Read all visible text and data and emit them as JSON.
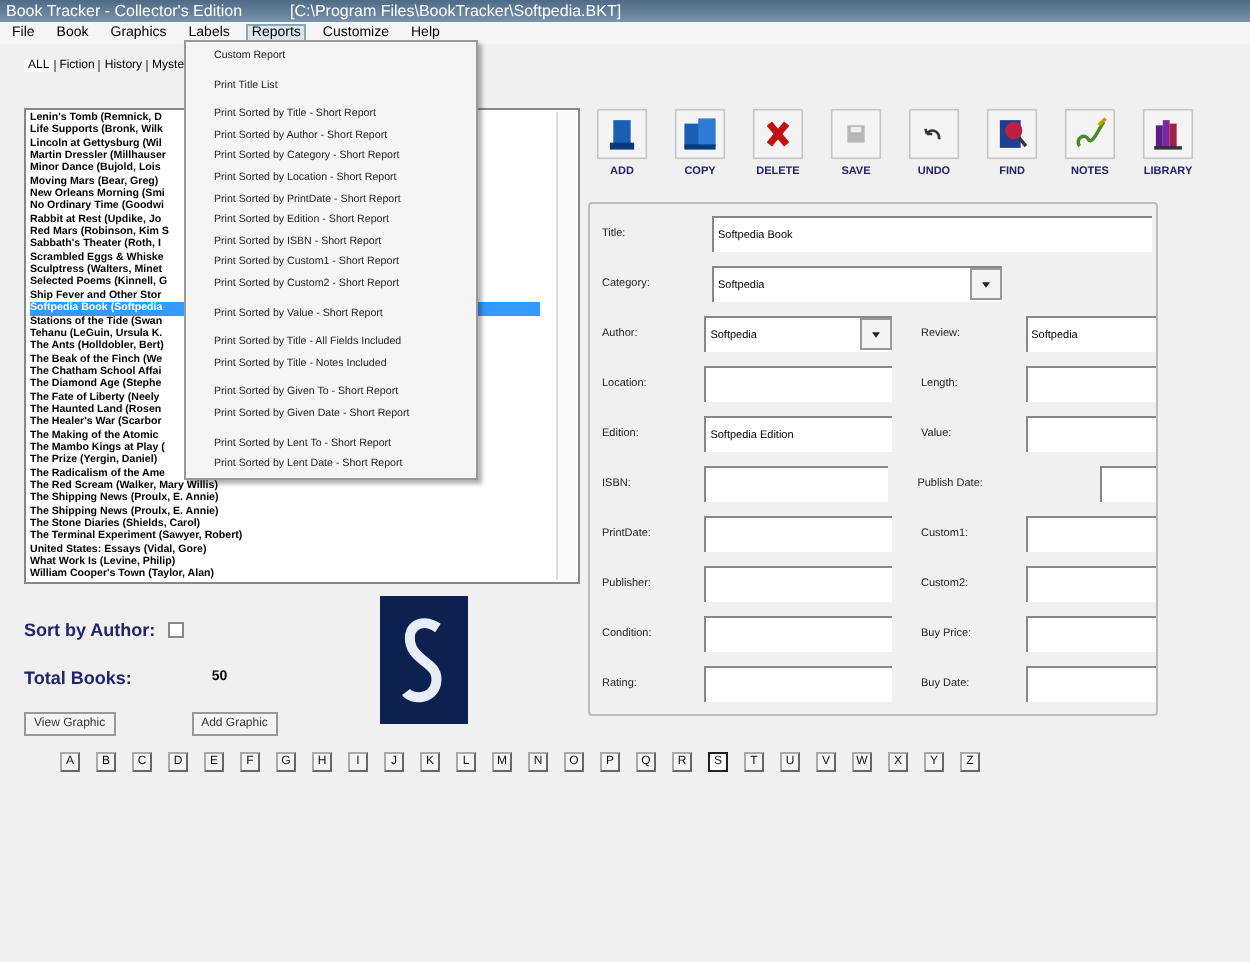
{
  "window": {
    "title": "Book Tracker - Collector's Edition",
    "path": "[C:\\Program Files\\BookTracker\\Softpedia.BKT]"
  },
  "menu": [
    {
      "label": "File",
      "selected": false
    },
    {
      "label": "Book",
      "selected": false
    },
    {
      "label": "Graphics",
      "selected": false
    },
    {
      "label": "Labels",
      "selected": false
    },
    {
      "label": "Reports",
      "selected": true
    },
    {
      "label": "Customize",
      "selected": false
    },
    {
      "label": "Help",
      "selected": false
    }
  ],
  "reports_menu": [
    [
      "Custom Report"
    ],
    [
      "Print Title List"
    ],
    [
      "Print Sorted by Title - Short Report",
      "Print Sorted by Author - Short Report",
      "Print Sorted by Category - Short Report",
      "Print Sorted by Location - Short Report",
      "Print Sorted by PrintDate - Short Report",
      "Print Sorted by Edition - Short Report",
      "Print Sorted by ISBN - Short Report",
      "Print Sorted by Custom1 - Short Report",
      "Print Sorted by Custom2 - Short Report"
    ],
    [
      "Print Sorted by Value - Short Report"
    ],
    [
      "Print Sorted by Title - All Fields Included",
      "Print Sorted by Title - Notes Included"
    ],
    [
      "Print Sorted by Given To - Short Report",
      "Print Sorted by Given Date - Short Report"
    ],
    [
      "Print Sorted by Lent To - Short Report",
      "Print Sorted by Lent Date - Short Report"
    ]
  ],
  "tabs": [
    {
      "label": "ALL",
      "selected": true
    },
    {
      "label": "Fiction",
      "selected": false
    },
    {
      "label": "History",
      "selected": false
    },
    {
      "label": "Myste",
      "selected": false
    }
  ],
  "books": [
    {
      "title": "Lenin's Tomb (Remnick, D",
      "selected": false
    },
    {
      "title": "Life Supports (Bronk, Wilk",
      "selected": false
    },
    {
      "title": "Lincoln at Gettysburg (Wil",
      "selected": false
    },
    {
      "title": "Martin Dressler (Millhauser",
      "selected": false
    },
    {
      "title": "Minor Dance (Bujold, Lois",
      "selected": false
    },
    {
      "title": "Moving Mars (Bear, Greg)",
      "selected": false
    },
    {
      "title": "New Orleans Morning (Smi",
      "selected": false
    },
    {
      "title": "No Ordinary Time (Goodwi",
      "selected": false
    },
    {
      "title": "Rabbit at Rest (Updike, Jo",
      "selected": false
    },
    {
      "title": "Red Mars (Robinson, Kim S",
      "selected": false
    },
    {
      "title": "Sabbath's Theater (Roth, I",
      "selected": false
    },
    {
      "title": "Scrambled Eggs & Whiske",
      "selected": false
    },
    {
      "title": "Sculptress (Walters, Minet",
      "selected": false
    },
    {
      "title": "Selected Poems (Kinnell, G",
      "selected": false
    },
    {
      "title": "Ship Fever and Other Stor",
      "selected": false
    },
    {
      "title": "Softpedia Book (Softpedia",
      "selected": true
    },
    {
      "title": "Stations of the Tide (Swan",
      "selected": false
    },
    {
      "title": "Tehanu (LeGuin, Ursula K.",
      "selected": false
    },
    {
      "title": "The Ants (Holldobler, Bert)",
      "selected": false
    },
    {
      "title": "The Beak of the Finch (We",
      "selected": false
    },
    {
      "title": "The Chatham School Affai",
      "selected": false
    },
    {
      "title": "The Diamond Age (Stephe",
      "selected": false
    },
    {
      "title": "The Fate of Liberty (Neely",
      "selected": false
    },
    {
      "title": "The Haunted Land (Rosen",
      "selected": false
    },
    {
      "title": "The Healer's War (Scarbor",
      "selected": false
    },
    {
      "title": "The Making of the Atomic",
      "selected": false
    },
    {
      "title": "The Mambo Kings at Play (",
      "selected": false
    },
    {
      "title": "The Prize (Yergin, Daniel)",
      "selected": false
    },
    {
      "title": "The Radicalism of the Ame",
      "selected": false
    },
    {
      "title": "The Red Scream (Walker, Mary Willis)",
      "selected": false
    },
    {
      "title": "The Shipping News (Proulx, E. Annie)",
      "selected": false
    },
    {
      "title": "The Shipping News (Proulx, E. Annie)",
      "selected": false
    },
    {
      "title": "The Stone Diaries (Shields, Carol)",
      "selected": false
    },
    {
      "title": "The Terminal Experiment (Sawyer, Robert)",
      "selected": false
    },
    {
      "title": "United States: Essays (Vidal, Gore)",
      "selected": false
    },
    {
      "title": "What Work Is (Levine, Philip)",
      "selected": false
    },
    {
      "title": "William Cooper's Town (Taylor, Alan)",
      "selected": false
    }
  ],
  "sort_by_author": {
    "label": "Sort by Author:",
    "checked": false
  },
  "total_books": {
    "label": "Total Books:",
    "value": "50"
  },
  "graphic_buttons": [
    "View Graphic",
    "Add Graphic"
  ],
  "cover": {
    "kind": "picture"
  },
  "toolbar": [
    "ADD",
    "COPY",
    "DELETE",
    "SAVE",
    "UNDO",
    "FIND",
    "NOTES",
    "LIBRARY"
  ],
  "form": {
    "title": {
      "label": "Title:",
      "value": "Softpedia Book"
    },
    "category": {
      "label": "Category:",
      "value": "Softpedia"
    },
    "rows": [
      {
        "left": {
          "label": "Author:",
          "value": "Softpedia",
          "kind": "dropdown"
        },
        "right": {
          "label": "Review:",
          "value": "Softpedia",
          "kind": "text"
        }
      },
      {
        "left": {
          "label": "Location:",
          "kind": "text"
        },
        "right": {
          "label": "Length:",
          "kind": "text"
        }
      },
      {
        "left": {
          "label": "Edition:",
          "value": "Softpedia Edition",
          "kind": "text"
        },
        "right": {
          "label": "Value:",
          "kind": "text"
        }
      },
      {
        "left": {
          "label": "ISBN:",
          "kind": "text"
        },
        "right": {
          "label": "Publish Date:",
          "kind": "short"
        }
      },
      {
        "left": {
          "label": "PrintDate:",
          "kind": "text"
        },
        "right": {
          "label": "Custom1:",
          "kind": "text"
        }
      },
      {
        "left": {
          "label": "Publisher:",
          "kind": "text"
        },
        "right": {
          "label": "Custom2:",
          "kind": "text"
        }
      },
      {
        "left": {
          "label": "Condition:",
          "kind": "text"
        },
        "right": {
          "label": "Buy Price:",
          "kind": "text"
        }
      },
      {
        "left": {
          "label": "Rating:",
          "kind": "text"
        },
        "right": {
          "label": "Buy Date:",
          "kind": "text"
        }
      }
    ]
  },
  "letters": [
    {
      "label": "A",
      "selected": false
    },
    {
      "label": "B",
      "selected": false
    },
    {
      "label": "C",
      "selected": false
    },
    {
      "label": "D",
      "selected": false
    },
    {
      "label": "E",
      "selected": false
    },
    {
      "label": "F",
      "selected": false
    },
    {
      "label": "G",
      "selected": false
    },
    {
      "label": "H",
      "selected": false
    },
    {
      "label": "I",
      "selected": false
    },
    {
      "label": "J",
      "selected": false
    },
    {
      "label": "K",
      "selected": false
    },
    {
      "label": "L",
      "selected": false
    },
    {
      "label": "M",
      "selected": false
    },
    {
      "label": "N",
      "selected": false
    },
    {
      "label": "O",
      "selected": false
    },
    {
      "label": "P",
      "selected": false
    },
    {
      "label": "Q",
      "selected": false
    },
    {
      "label": "R",
      "selected": false
    },
    {
      "label": "S",
      "selected": true
    },
    {
      "label": "T",
      "selected": false
    },
    {
      "label": "U",
      "selected": false
    },
    {
      "label": "V",
      "selected": false
    },
    {
      "label": "W",
      "selected": false
    },
    {
      "label": "X",
      "selected": false
    },
    {
      "label": "Y",
      "selected": false
    },
    {
      "label": "Z",
      "selected": false
    }
  ]
}
